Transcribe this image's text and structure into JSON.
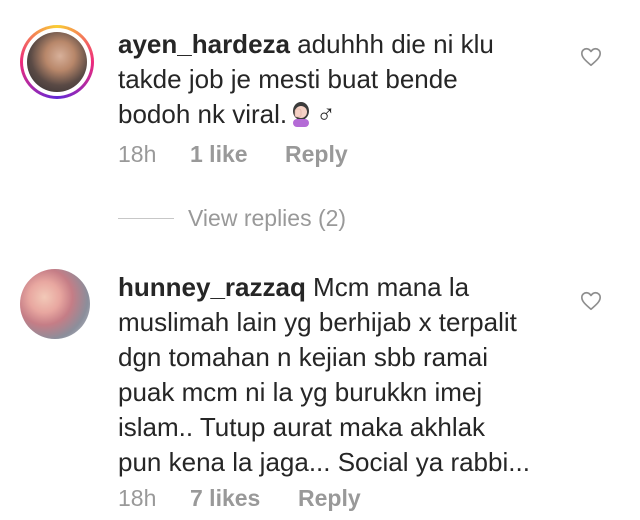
{
  "comments": [
    {
      "username": "ayen_hardeza",
      "lines": [
        " aduhhh die ni klu",
        "takde job je mesti buat bende",
        "bodoh nk viral."
      ],
      "emoji_suffix": "♂",
      "emoji_icon": "woman-facepalming-icon",
      "time": "18h",
      "likes": "1 like",
      "reply": "Reply"
    },
    {
      "username": "hunney_razzaq",
      "lines": [
        " Mcm mana la",
        "muslimah lain yg berhijab x terpalit",
        "dgn tomahan n kejian sbb ramai",
        "puak mcm ni la yg burukkn imej",
        "islam.. Tutup aurat maka akhlak",
        "pun kena la jaga... Social ya rabbi..."
      ],
      "time": "18h",
      "likes": "7 likes",
      "reply": "Reply"
    }
  ],
  "view_replies": "View replies (2)",
  "colors": {
    "text": "#262626",
    "meta": "#999999",
    "divider": "#c7c7c7",
    "ring_start": "#f9ce34",
    "ring_mid": "#ee2a7b",
    "ring_end": "#6228d7"
  }
}
